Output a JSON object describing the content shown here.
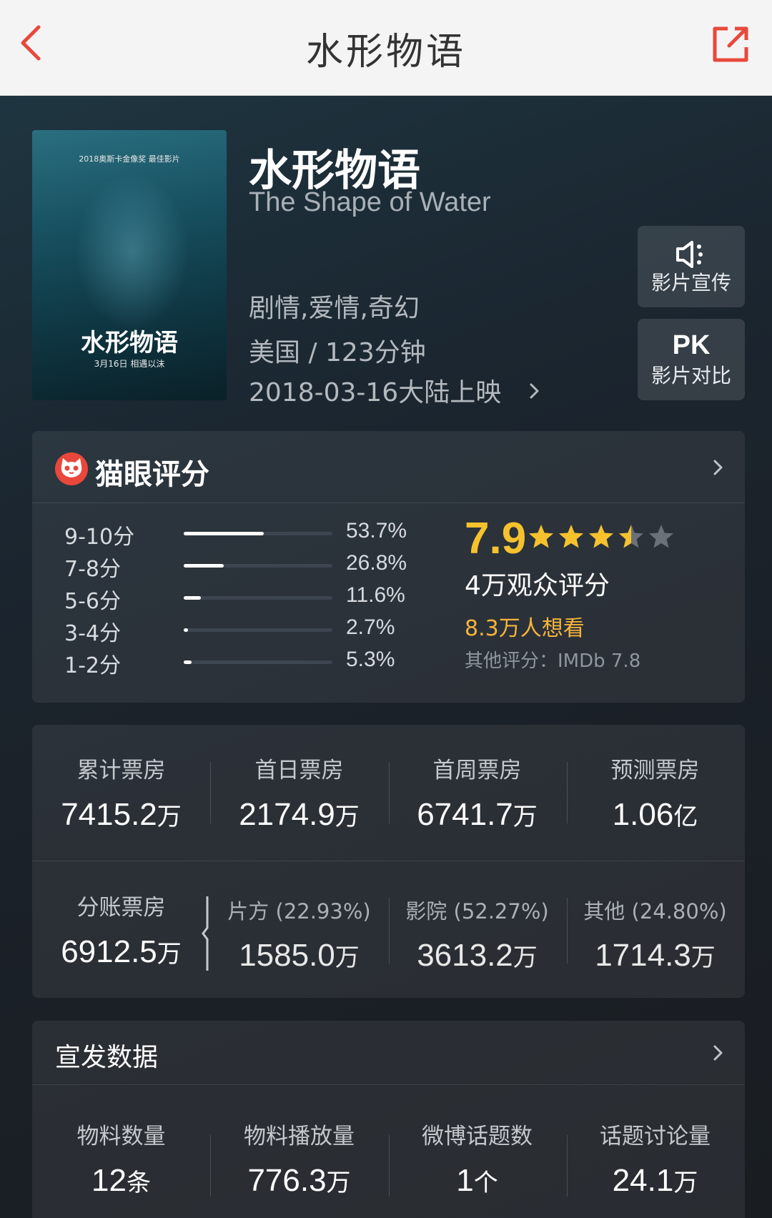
{
  "nav": {
    "title": "水形物语"
  },
  "movie": {
    "title_cn": "水形物语",
    "title_en": "The Shape of Water",
    "genre": "剧情,爱情,奇幻",
    "country_duration": "美国 / 123分钟",
    "release": "2018-03-16大陆上映",
    "poster_title": "水形物语",
    "poster_date": "3月16日 相遇以沫",
    "poster_top": "2018奥斯卡金像奖 最佳影片"
  },
  "side_buttons": {
    "promo_label": "影片宣传",
    "pk_icon": "PK",
    "pk_label": "影片对比"
  },
  "rating": {
    "title": "猫眼评分",
    "distribution": [
      {
        "label": "9-10分",
        "pct": "53.7%",
        "value": 53.7
      },
      {
        "label": "7-8分",
        "pct": "26.8%",
        "value": 26.8
      },
      {
        "label": "5-6分",
        "pct": "11.6%",
        "value": 11.6
      },
      {
        "label": "3-4分",
        "pct": "2.7%",
        "value": 2.7
      },
      {
        "label": "1-2分",
        "pct": "5.3%",
        "value": 5.3
      }
    ],
    "score": "7.9",
    "stars_value": 3.5,
    "score_count": "4万观众评分",
    "want_see": "8.3万人想看",
    "other_score": "其他评分：IMDb 7.8",
    "score_color": "#f5c22e",
    "star_color": "#f5c22e"
  },
  "box_office": {
    "row1": [
      {
        "caption": "累计票房",
        "value": "7415.2",
        "unit": "万"
      },
      {
        "caption": "首日票房",
        "value": "2174.9",
        "unit": "万"
      },
      {
        "caption": "首周票房",
        "value": "6741.7",
        "unit": "万"
      },
      {
        "caption": "预测票房",
        "value": "1.06",
        "unit": "亿"
      }
    ],
    "split_total": {
      "caption": "分账票房",
      "value": "6912.5",
      "unit": "万"
    },
    "row2": [
      {
        "caption": "片方 (22.93%)",
        "value": "1585.0",
        "unit": "万"
      },
      {
        "caption": "影院 (52.27%)",
        "value": "3613.2",
        "unit": "万"
      },
      {
        "caption": "其他 (24.80%)",
        "value": "1714.3",
        "unit": "万"
      }
    ]
  },
  "promo": {
    "title": "宣发数据",
    "stats": [
      {
        "caption": "物料数量",
        "value": "12",
        "unit": "条"
      },
      {
        "caption": "物料播放量",
        "value": "776.3",
        "unit": "万"
      },
      {
        "caption": "微博话题数",
        "value": "1",
        "unit": "个"
      },
      {
        "caption": "话题讨论量",
        "value": "24.1",
        "unit": "万"
      }
    ]
  }
}
